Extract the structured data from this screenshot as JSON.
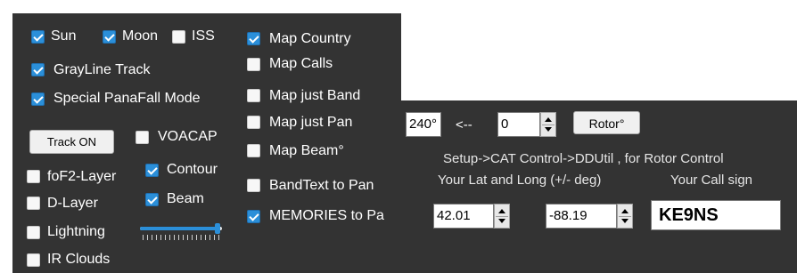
{
  "left_panel": {
    "options": {
      "sun": {
        "label": "Sun",
        "checked": true
      },
      "moon": {
        "label": "Moon",
        "checked": true
      },
      "iss": {
        "label": "ISS",
        "checked": false
      },
      "grayline": {
        "label": "GrayLine Track",
        "checked": true
      },
      "panafall": {
        "label": "Special PanaFall Mode",
        "checked": true
      },
      "voacap": {
        "label": "VOACAP",
        "checked": false
      },
      "fof2": {
        "label": "foF2-Layer",
        "checked": false
      },
      "contour": {
        "label": "Contour",
        "checked": true
      },
      "dlayer": {
        "label": "D-Layer",
        "checked": false
      },
      "beam": {
        "label": "Beam",
        "checked": true
      },
      "lightning": {
        "label": "Lightning",
        "checked": false
      },
      "ir_clouds": {
        "label": "IR Clouds",
        "checked": false
      }
    },
    "track_button": "Track ON",
    "slider_level_percent": 95,
    "map_options": {
      "map_country": {
        "label": "Map Country",
        "checked": true
      },
      "map_calls": {
        "label": "Map Calls",
        "checked": false
      },
      "map_band": {
        "label": "Map just Band",
        "checked": false
      },
      "map_pan": {
        "label": "Map just Pan",
        "checked": false
      },
      "map_beam": {
        "label": "Map Beam°",
        "checked": false
      },
      "bandtext": {
        "label": "BandText to Pan",
        "checked": false
      },
      "memories": {
        "label": "MEMORIES to Pa",
        "checked": true
      }
    }
  },
  "rotor": {
    "bearing_value": "240°",
    "arrow": "<--",
    "offset_value": "0",
    "button": "Rotor°",
    "setup_hint": "Setup->CAT Control->DDUtil , for Rotor Control",
    "latlong_label": "Your Lat and Long (+/- deg)",
    "callsign_label": "Your Call sign",
    "lat_value": "42.01",
    "long_value": "-88.19",
    "callsign_value": "KE9NS"
  },
  "colors": {
    "panel_bg": "#333333",
    "checkbox_checked": "#2b8fd9",
    "text": "#ffffff"
  }
}
